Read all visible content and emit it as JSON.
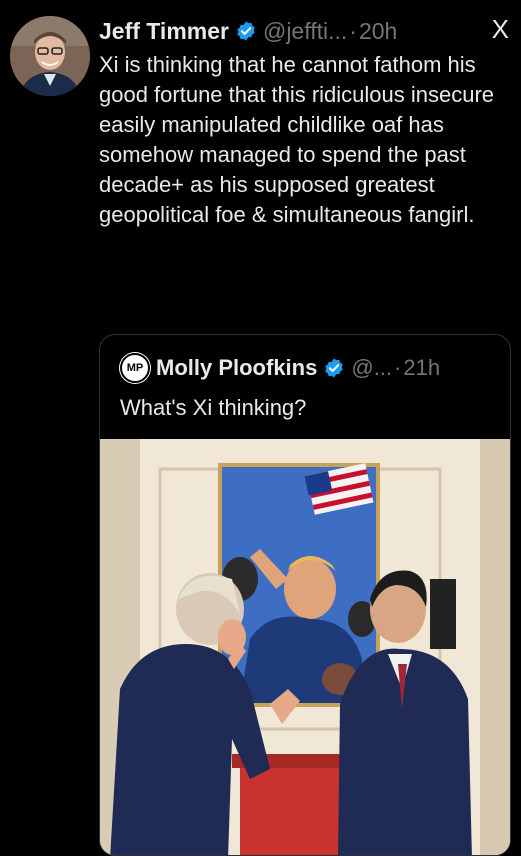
{
  "tweet": {
    "author_name": "Jeff Timmer",
    "handle": "@jeffti...",
    "separator": "·",
    "time": "20h",
    "text": "Xi is thinking that he cannot fathom his good fortune that this ridiculous insecure easily manipulated childlike oaf has somehow managed to spend the past decade+ as his supposed greatest geopolitical foe & simultaneous fangirl."
  },
  "close_glyph": "X",
  "quoted": {
    "avatar_text": "MP",
    "author_name": "Molly Ploofkins",
    "handle": "@...",
    "separator": "·",
    "time": "21h",
    "text": "What's Xi thinking?"
  },
  "colors": {
    "background": "#000000",
    "verified": "#1d9bf0",
    "muted": "#71767b",
    "text": "#e7e9ea"
  }
}
